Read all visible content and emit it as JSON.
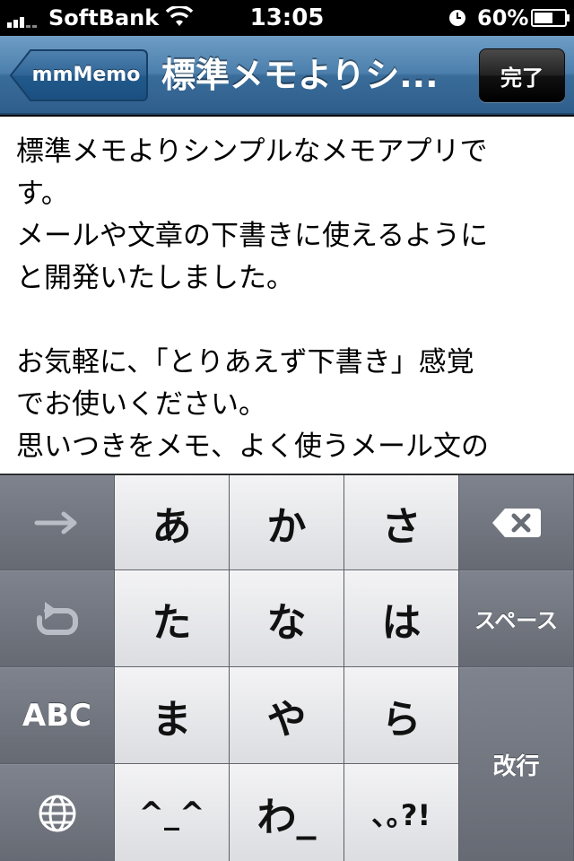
{
  "status_bar": {
    "carrier": "SoftBank",
    "time": "13:05",
    "battery": "60%"
  },
  "nav": {
    "back_label": "mmMemo",
    "title": "標準メモよりシ...",
    "done_label": "完了"
  },
  "memo": {
    "text": "標準メモよりシンプルなメモアプリで\nす。\nメールや文章の下書きに使えるように\nと開発いたしました。\n\nお気軽に、「とりあえず下書き」感覚\nでお使いください。\n思いつきをメモ、よく使うメール文の\nテンプレート用に、長文を書く前の短"
  },
  "keyboard": {
    "row1": [
      "あ",
      "か",
      "さ"
    ],
    "row2": [
      "た",
      "な",
      "は"
    ],
    "row3": [
      "ま",
      "や",
      "ら"
    ],
    "row4": [
      "^_^",
      "わ_",
      "､｡?!"
    ],
    "space_label": "スペース",
    "abc_label": "ABC",
    "return_label": "改行"
  },
  "icons": {
    "next": "arrow-right-icon",
    "undo": "undo-icon",
    "globe": "globe-icon",
    "delete": "backspace-icon"
  },
  "colors": {
    "nav_blue": "#4c7fac",
    "keyboard_bg": "#484b52",
    "key_light": "#e8e9ec",
    "key_dark": "#6f737c"
  }
}
